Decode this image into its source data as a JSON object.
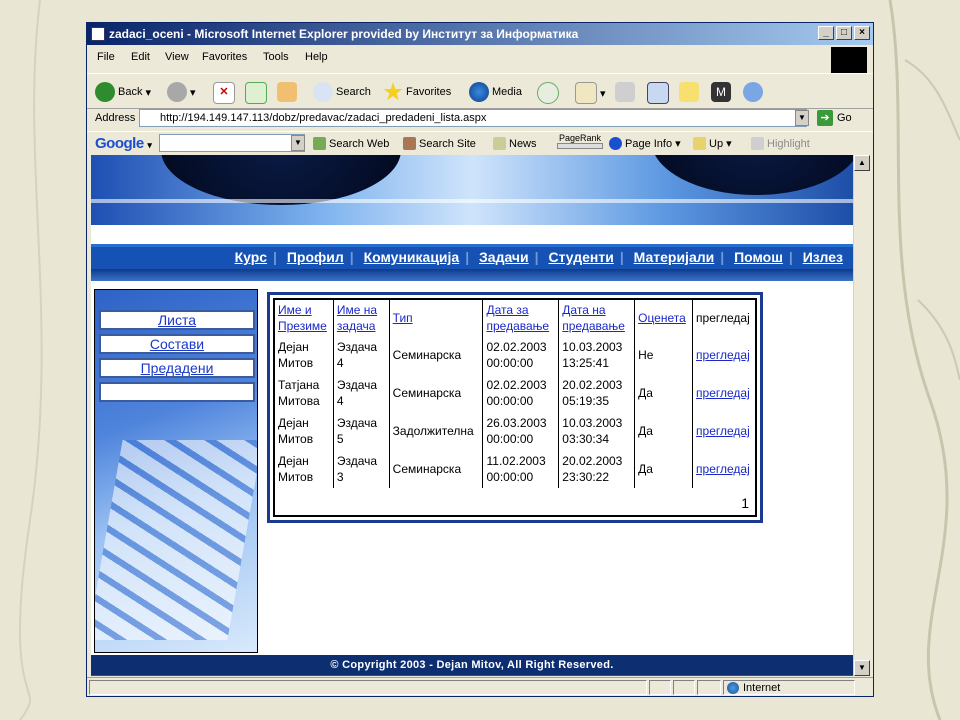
{
  "window": {
    "title": "zadaci_oceni - Microsoft Internet Explorer provided by Институт за Информатика",
    "buttons": [
      "_",
      "□",
      "×"
    ]
  },
  "menu": [
    "File",
    "Edit",
    "View",
    "Favorites",
    "Tools",
    "Help"
  ],
  "toolbar": {
    "back": "Back",
    "search": "Search",
    "favorites": "Favorites",
    "media": "Media"
  },
  "address": {
    "label": "Address",
    "url": "http://194.149.147.113/dobz/predavac/zadaci_predadeni_lista.aspx",
    "go": "Go"
  },
  "google_bar": {
    "logo": "Google",
    "search_web": "Search Web",
    "search_site": "Search Site",
    "news": "News",
    "pagerank": "PageRank",
    "page_info": "Page Info",
    "up": "Up",
    "highlight": "Highlight"
  },
  "nav": [
    "Курс",
    "Профил",
    "Комуникација",
    "Задачи",
    "Студенти",
    "Материјали",
    "Помош",
    "Излез"
  ],
  "sidebar": [
    "Листа",
    "Состави",
    "Предадени",
    ""
  ],
  "table": {
    "headers": [
      "Име и Презиме",
      "Име на задача",
      "Тип",
      "Дата за предавање",
      "Дата на предавање",
      "Оценета",
      "прегледај"
    ],
    "rows": [
      [
        "Дејан Митов",
        "Эздача 4",
        "Семинарска",
        "02.02.2003 00:00:00",
        "10.03.2003 13:25:41",
        "Не",
        "прегледај"
      ],
      [
        "Татјана Митова",
        "Эздача 4",
        "Семинарска",
        "02.02.2003 00:00:00",
        "20.02.2003 05:19:35",
        "Да",
        "прегледај"
      ],
      [
        "Дејан Митов",
        "Эздача 5",
        "Задолжителна",
        "26.03.2003 00:00:00",
        "10.03.2003 03:30:34",
        "Да",
        "прегледај"
      ],
      [
        "Дејан Митов",
        "Эздача 3",
        "Семинарска",
        "11.02.2003 00:00:00",
        "20.02.2003 23:30:22",
        "Да",
        "прегледај"
      ]
    ],
    "pager": "1"
  },
  "footer": {
    "copyright": "© Copyright 2003 - Dejan Mitov, All Right Reserved."
  },
  "status": {
    "zone": "Internet"
  }
}
